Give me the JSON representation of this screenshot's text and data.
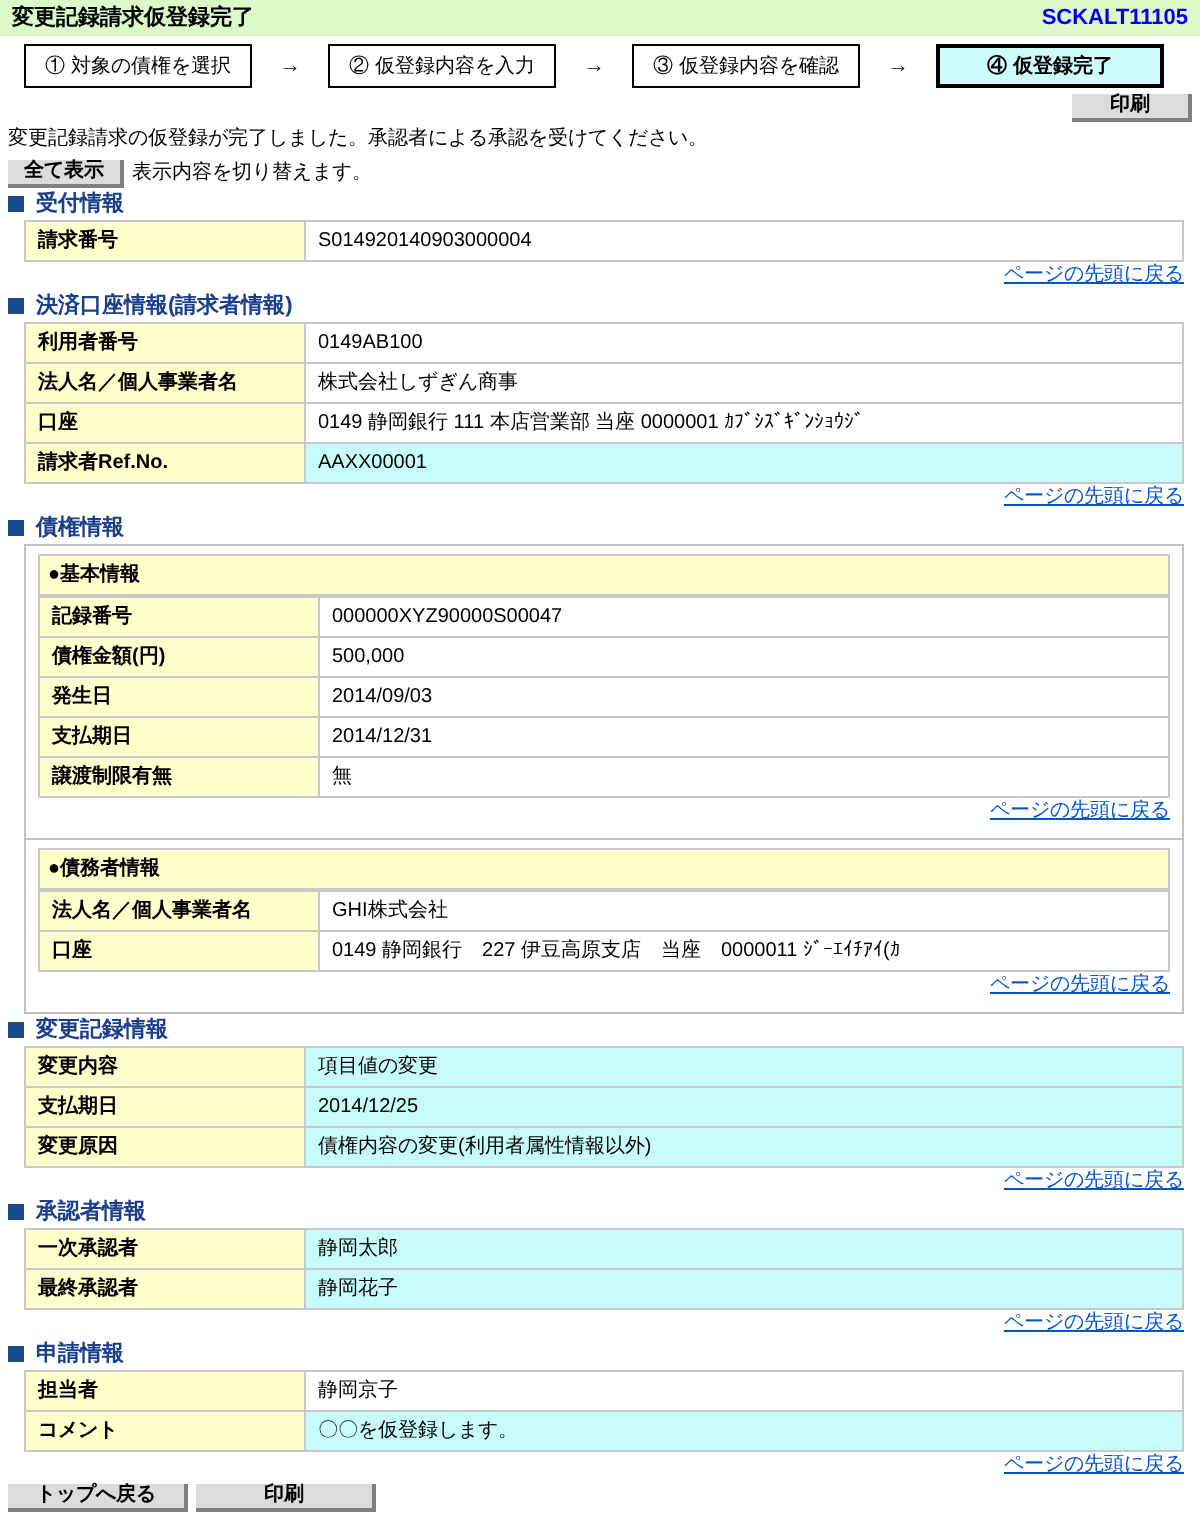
{
  "title": "変更記録請求仮登録完了",
  "screen_id": "SCKALT11105",
  "steps": [
    {
      "label": "① 対象の債権を選択",
      "selected": false
    },
    {
      "label": "② 仮登録内容を入力",
      "selected": false
    },
    {
      "label": "③ 仮登録内容を確認",
      "selected": false
    },
    {
      "label": "④ 仮登録完了",
      "selected": true
    }
  ],
  "step_arrow": "→",
  "print_button_top": "印刷",
  "message": "変更記録請求の仮登録が完了しました。承認者による承認を受けてください。",
  "toggle_button": "全て表示",
  "toggle_note": "表示内容を切り替えます。",
  "sections": [
    {
      "kind": "table",
      "title": "受付情報",
      "back_link": "ページの先頭に戻る",
      "rows": [
        {
          "label": "請求番号",
          "value": "S014920140903000004",
          "changed": false
        }
      ]
    },
    {
      "kind": "table",
      "title": "決済口座情報(請求者情報)",
      "back_link": "ページの先頭に戻る",
      "rows": [
        {
          "label": "利用者番号",
          "value": "0149AB100",
          "changed": false
        },
        {
          "label": "法人名／個人事業者名",
          "value": "株式会社しずぎん商事",
          "changed": false
        },
        {
          "label": "口座",
          "value": "0149 静岡銀行 111 本店営業部 当座 0000001 ｶﾌﾞｼｽﾞｷﾞﾝｼｮｳｼﾞ",
          "changed": false
        },
        {
          "label": "請求者Ref.No.",
          "value": "AAXX00001",
          "changed": true
        }
      ]
    },
    {
      "kind": "groups",
      "title": "債権情報",
      "groups": [
        {
          "title": "●基本情報",
          "back_link": "ページの先頭に戻る",
          "rows": [
            {
              "label": "記録番号",
              "value": "000000XYZ90000S00047",
              "changed": false
            },
            {
              "label": "債権金額(円)",
              "value": "500,000",
              "changed": false
            },
            {
              "label": "発生日",
              "value": "2014/09/03",
              "changed": false
            },
            {
              "label": "支払期日",
              "value": "2014/12/31",
              "changed": false
            },
            {
              "label": "譲渡制限有無",
              "value": "無",
              "changed": false
            }
          ]
        },
        {
          "title": "●債務者情報",
          "back_link": "ページの先頭に戻る",
          "rows": [
            {
              "label": "法人名／個人事業者名",
              "value": "GHI株式会社",
              "changed": false
            },
            {
              "label": "口座",
              "value": "0149 静岡銀行　227 伊豆高原支店　当座　0000011 ｼﾞｰｴｲﾁｱｲ(ｶ",
              "changed": false
            }
          ]
        }
      ]
    },
    {
      "kind": "table",
      "title": "変更記録情報",
      "back_link": "ページの先頭に戻る",
      "rows": [
        {
          "label": "変更内容",
          "value": "項目値の変更",
          "changed": true
        },
        {
          "label": "支払期日",
          "value": "2014/12/25",
          "changed": true
        },
        {
          "label": "変更原因",
          "value": "債権内容の変更(利用者属性情報以外)",
          "changed": true
        }
      ]
    },
    {
      "kind": "table",
      "title": "承認者情報",
      "back_link": "ページの先頭に戻る",
      "rows": [
        {
          "label": "一次承認者",
          "value": "静岡太郎",
          "changed": true
        },
        {
          "label": "最終承認者",
          "value": "静岡花子",
          "changed": true
        }
      ]
    },
    {
      "kind": "table",
      "title": "申請情報",
      "back_link": "ページの先頭に戻る",
      "rows": [
        {
          "label": "担当者",
          "value": "静岡京子",
          "changed": false
        },
        {
          "label": "コメント",
          "value": "〇〇を仮登録します。",
          "changed": true
        }
      ]
    }
  ],
  "bottom_buttons": [
    "トップへ戻る",
    "印刷"
  ]
}
